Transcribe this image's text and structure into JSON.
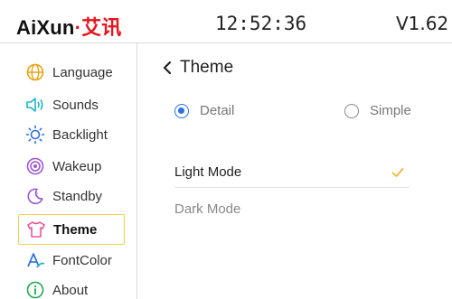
{
  "header": {
    "brand_latin": "AiXun",
    "brand_dot": "·",
    "brand_cn": "艾讯",
    "clock": "12:52:36",
    "version": "V1.62"
  },
  "sidebar": {
    "items": [
      {
        "label": "Language",
        "icon": "globe-icon"
      },
      {
        "label": "Sounds",
        "icon": "speaker-icon"
      },
      {
        "label": "Backlight",
        "icon": "sun-icon"
      },
      {
        "label": "Wakeup",
        "icon": "wakeup-icon"
      },
      {
        "label": "Standby",
        "icon": "moon-icon"
      },
      {
        "label": "Theme",
        "icon": "shirt-icon",
        "active": true
      },
      {
        "label": "FontColor",
        "icon": "font-color-icon"
      },
      {
        "label": "About",
        "icon": "info-icon"
      }
    ]
  },
  "main": {
    "title": "Theme",
    "style_options": [
      {
        "label": "Detail",
        "selected": true
      },
      {
        "label": "Simple",
        "selected": false
      }
    ],
    "modes": [
      {
        "label": "Light Mode",
        "checked": true
      },
      {
        "label": "Dark Mode",
        "checked": false
      }
    ]
  },
  "colors": {
    "accent_red": "#e4161d",
    "active_border": "#f3d24a",
    "icon_gold": "#e8a317",
    "icon_teal": "#1bb5c9",
    "icon_blue": "#2d6fe0",
    "icon_purple": "#9b59d6",
    "icon_pink": "#e8569a",
    "check_orange": "#f0b43a",
    "radio_blue": "#2d6fe0"
  }
}
